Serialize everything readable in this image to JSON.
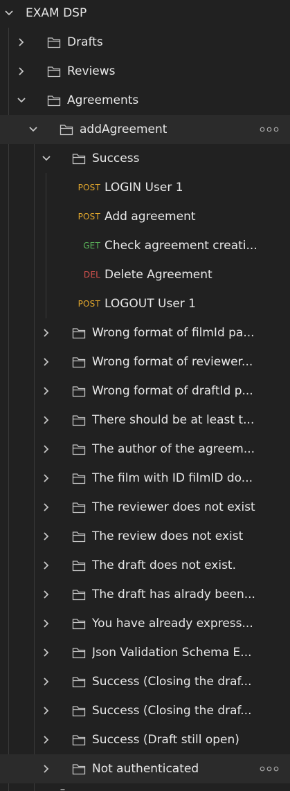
{
  "collection": {
    "name": "EXAM DSP"
  },
  "folders_top": [
    {
      "label": "Drafts"
    },
    {
      "label": "Reviews"
    },
    {
      "label": "Agreements"
    }
  ],
  "add_agreement": {
    "label": "addAgreement"
  },
  "success_folder": {
    "label": "Success"
  },
  "requests": [
    {
      "method": "POST",
      "label": "LOGIN User 1"
    },
    {
      "method": "POST",
      "label": "Add agreement"
    },
    {
      "method": "GET",
      "label": "Check agreement creati..."
    },
    {
      "method": "DEL",
      "label": "Delete Agreement"
    },
    {
      "method": "POST",
      "label": "LOGOUT User 1"
    }
  ],
  "subfolders": [
    {
      "label": "Wrong format of filmId pa..."
    },
    {
      "label": "Wrong format of reviewer..."
    },
    {
      "label": "Wrong format of draftId p..."
    },
    {
      "label": "There should be at least t..."
    },
    {
      "label": "The author of the agreem..."
    },
    {
      "label": "The film with ID filmID do..."
    },
    {
      "label": "The reviewer does not exist"
    },
    {
      "label": "The review does not exist"
    },
    {
      "label": "The draft does not exist."
    },
    {
      "label": "The draft has alrady been..."
    },
    {
      "label": "You have already express..."
    },
    {
      "label": "Json Validation Schema E..."
    },
    {
      "label": "Success (Closing the draf..."
    },
    {
      "label": "Success (Closing the draf..."
    },
    {
      "label": "Success (Draft still open)"
    },
    {
      "label": "Not authenticated"
    }
  ],
  "colors": {
    "background": "#212121",
    "selected_row": "#2b2b2b",
    "text": "#e8e8e8",
    "icon": "#c8c8c8",
    "post": "#e5a92d",
    "get": "#5cb85c",
    "del": "#d9534f",
    "guide": "#3a3a3a"
  }
}
